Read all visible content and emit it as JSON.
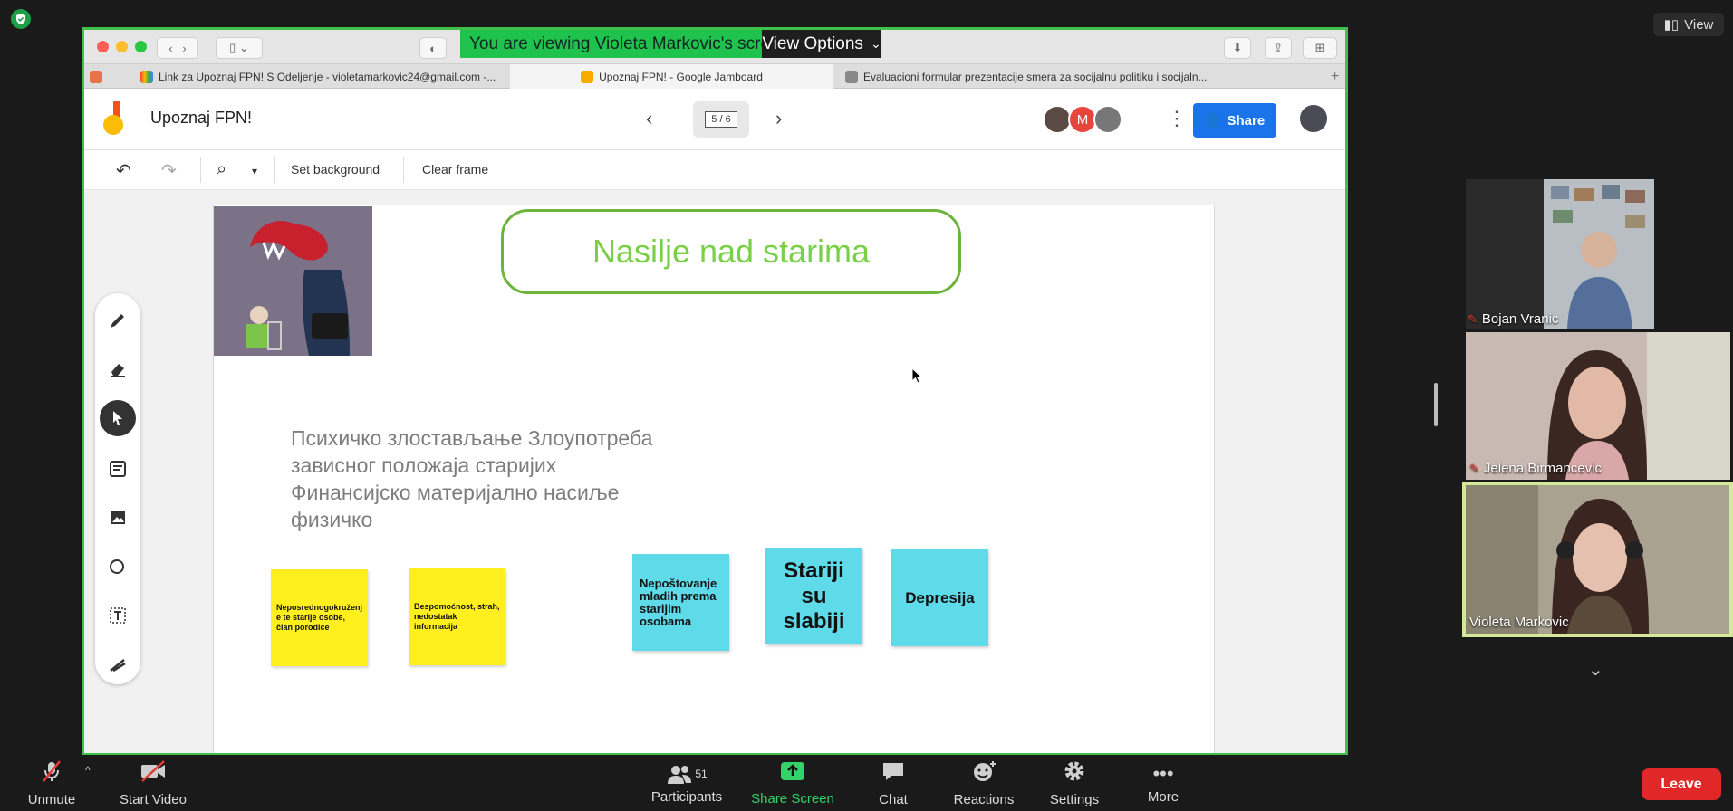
{
  "zoom": {
    "view_button": "View",
    "banner_text": "You are viewing Violeta Markovic's screen",
    "view_options": "View Options"
  },
  "browser": {
    "tabs": [
      {
        "label": "Link za Upoznaj FPN! S Odeljenje - violetamarkovic24@gmail.com -...",
        "icon": "gmail-icon"
      },
      {
        "label": "Upoznaj FPN! - Google Jamboard",
        "icon": "jamboard-icon"
      },
      {
        "label": "Evaluacioni formular prezentacije smera za socijalnu politiku i socijaln...",
        "icon": "google-forms-icon"
      }
    ]
  },
  "jamboard": {
    "title": "Upoznaj FPN!",
    "frame_indicator": "5 / 6",
    "share_label": "Share",
    "toolbar": {
      "set_background": "Set background",
      "clear_frame": "Clear frame"
    },
    "collaborator_initial": "M",
    "board": {
      "title": "Nasilje nad starima",
      "body_lines": [
        "Психичко злостављање Злоупотреба",
        "зависног положаја старијих",
        "Финансијско материјално насиље",
        "физичко"
      ],
      "stickies": [
        {
          "text": "Neposrednogokruženj e te starije osobe, član porodice",
          "color": "#ffef1f"
        },
        {
          "text": "Bespomoćnost, strah, nedostatak informacija",
          "color": "#ffef1f"
        },
        {
          "text": "Nepoštovanje mladih prema starijim osobama",
          "color": "#5fdae8"
        },
        {
          "text": "Stariji su slabiji",
          "color": "#5fdae8"
        },
        {
          "text": "Depresija",
          "color": "#5fdae8"
        }
      ]
    }
  },
  "participants": [
    {
      "name": "Bojan Vranic",
      "muted": true
    },
    {
      "name": "Jelena Birmancevic",
      "muted": true
    },
    {
      "name": "Violeta Markovic",
      "muted": false
    }
  ],
  "bottom_bar": {
    "unmute": "Unmute",
    "start_video": "Start Video",
    "participants": "Participants",
    "participants_count": "51",
    "share_screen": "Share Screen",
    "chat": "Chat",
    "reactions": "Reactions",
    "settings": "Settings",
    "more": "More",
    "leave": "Leave"
  },
  "colors": {
    "share_border": "#3fc04a",
    "leave": "#e02828",
    "share_button": "#1a73e8",
    "title_green": "#79d047"
  }
}
